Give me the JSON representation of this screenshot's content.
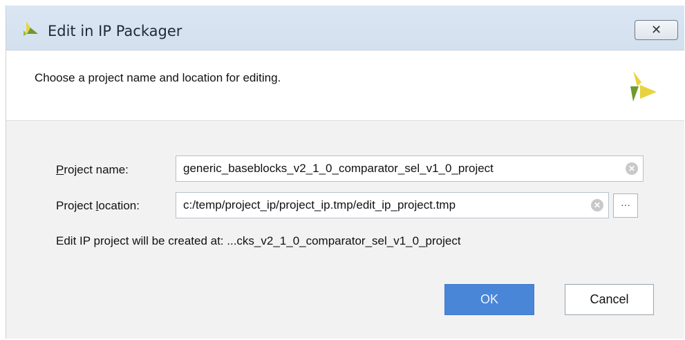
{
  "window": {
    "title": "Edit in IP Packager",
    "close_glyph": "✕"
  },
  "header": {
    "instruction": "Choose a project name and location for editing."
  },
  "form": {
    "project_name": {
      "label_mnemonic": "P",
      "label_rest": "roject name:",
      "value": "generic_baseblocks_v2_1_0_comparator_sel_v1_0_project"
    },
    "project_location": {
      "label_prefix": "Project ",
      "label_mnemonic": "l",
      "label_rest": "ocation:",
      "value": "c:/temp/project_ip/project_ip.tmp/edit_ip_project.tmp",
      "browse_label": "···"
    },
    "created_at": "Edit IP project will be created at: ...cks_v2_1_0_comparator_sel_v1_0_project"
  },
  "buttons": {
    "ok": "OK",
    "cancel": "Cancel"
  },
  "colors": {
    "ok_button": "#4a86d8",
    "logo_yellow": "#e8d33f",
    "logo_green": "#6e9a2d",
    "titlebar": "#d8e4f1"
  },
  "icons": {
    "title_logo": "xilinx-logo-icon",
    "header_logo": "xilinx-logo-icon",
    "clear": "clear-circle-icon"
  }
}
